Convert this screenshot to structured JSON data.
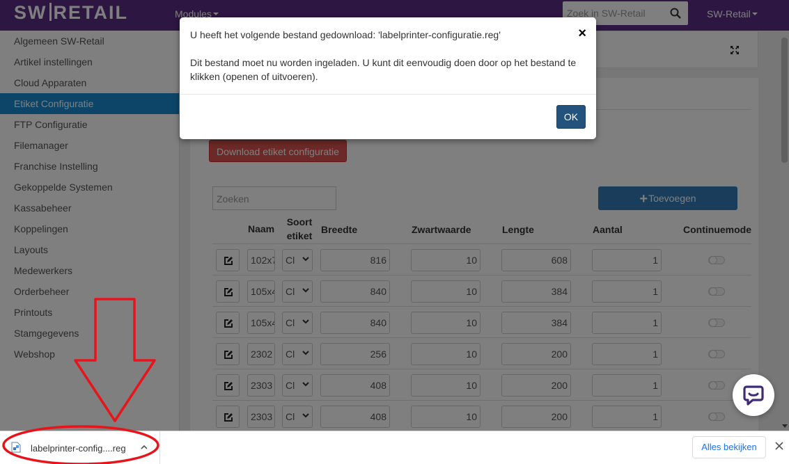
{
  "topbar": {
    "logo_left": "SW",
    "logo_right": "RETAIL",
    "modules_label": "Modules",
    "search_placeholder": "Zoek in SW-Retail",
    "user_label": "SW-Retail"
  },
  "sidebar": {
    "items": [
      {
        "label": "Algemeen SW-Retail"
      },
      {
        "label": "Artikel instellingen"
      },
      {
        "label": "Cloud Apparaten"
      },
      {
        "label": "Etiket Configuratie",
        "active": true
      },
      {
        "label": "FTP Configuratie"
      },
      {
        "label": "Filemanager"
      },
      {
        "label": "Franchise Instelling"
      },
      {
        "label": "Gekoppelde Systemen"
      },
      {
        "label": "Kassabeheer"
      },
      {
        "label": "Koppelingen"
      },
      {
        "label": "Layouts"
      },
      {
        "label": "Medewerkers"
      },
      {
        "label": "Orderbeheer"
      },
      {
        "label": "Printouts"
      },
      {
        "label": "Stamgegevens"
      },
      {
        "label": "Webshop"
      }
    ]
  },
  "main": {
    "download_button": "Download etiket configuratie",
    "search_placeholder": "Zoeken",
    "add_button": "Toevoegen",
    "columns": {
      "naam": "Naam",
      "soort": "Soort etiket",
      "breedte": "Breedte",
      "zwartwaarde": "Zwartwaarde",
      "lengte": "Lengte",
      "aantal": "Aantal",
      "continuemode": "Continuemode"
    },
    "rows": [
      {
        "naam": "102x7",
        "soort": "Cl",
        "breedte": "816",
        "zwartwaarde": "10",
        "lengte": "608",
        "aantal": "1"
      },
      {
        "naam": "105x4",
        "soort": "Cl",
        "breedte": "840",
        "zwartwaarde": "10",
        "lengte": "384",
        "aantal": "1"
      },
      {
        "naam": "105x4",
        "soort": "Cl",
        "breedte": "840",
        "zwartwaarde": "10",
        "lengte": "384",
        "aantal": "1"
      },
      {
        "naam": "2302",
        "soort": "Cl",
        "breedte": "256",
        "zwartwaarde": "10",
        "lengte": "200",
        "aantal": "1"
      },
      {
        "naam": "2303",
        "soort": "Cl",
        "breedte": "408",
        "zwartwaarde": "10",
        "lengte": "200",
        "aantal": "1"
      },
      {
        "naam": "2303",
        "soort": "Cl",
        "breedte": "408",
        "zwartwaarde": "10",
        "lengte": "200",
        "aantal": "1"
      }
    ]
  },
  "modal": {
    "title": "U heeft het volgende bestand gedownload: 'labelprinter-configuratie.reg'",
    "close_label": "×",
    "body": "Dit bestand moet nu worden ingeladen. U kunt dit eenvoudig doen door op het bestand te klikken (openen of uitvoeren).",
    "ok_label": "OK"
  },
  "download_bar": {
    "filename": "labelprinter-config....reg",
    "show_all": "Alles bekijken"
  },
  "colors": {
    "brand_purple": "#5a2d82",
    "active_blue": "#1b8bd0",
    "danger_red": "#d9534f",
    "primary_blue": "#337ab7",
    "annotation_red": "#e8141b"
  }
}
